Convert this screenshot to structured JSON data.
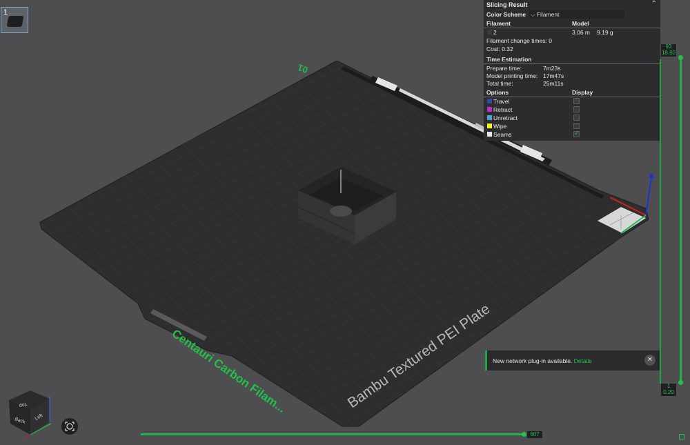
{
  "plate_thumbnail": {
    "number": "1"
  },
  "slicing_result": {
    "title": "Slicing Result",
    "color_scheme_label": "Color Scheme",
    "color_scheme_value": "Filament",
    "filament_header": "Filament",
    "model_header": "Model",
    "filament_id": "2",
    "length": "3.06 m",
    "weight": "9.19 g",
    "filament_change_times": "Filament change times: 0",
    "cost": "Cost: 0.32",
    "time_estimation": {
      "title": "Time Estimation",
      "prepare_label": "Prepare time:",
      "prepare_value": "7m23s",
      "printing_label": "Model printing time:",
      "printing_value": "17m47s",
      "total_label": "Total time:",
      "total_value": "25m11s"
    },
    "options_header": "Options",
    "display_header": "Display",
    "options": [
      {
        "label": "Travel",
        "color": "#2f4aa0",
        "checked": false
      },
      {
        "label": "Retract",
        "color": "#c22bc2",
        "checked": false
      },
      {
        "label": "Unretract",
        "color": "#47a5d8",
        "checked": false
      },
      {
        "label": "Wipe",
        "color": "#f2f21e",
        "checked": false
      },
      {
        "label": "Seams",
        "color": "#e6e6e6",
        "checked": true
      }
    ]
  },
  "layer_slider": {
    "top_layer": "93",
    "top_height": "18.60",
    "bottom_layer": "1",
    "bottom_height": "0.20"
  },
  "move_slider": {
    "value": "607"
  },
  "notification": {
    "message": "New network plug-in available.",
    "link": "Details"
  },
  "plate": {
    "label": "Bambu Textured PEI Plate",
    "filament_label": "Centauri Carbon Filam...",
    "plate_number": "01"
  },
  "view_cube": {
    "top": "Top",
    "back": "Back",
    "left": "Left"
  }
}
